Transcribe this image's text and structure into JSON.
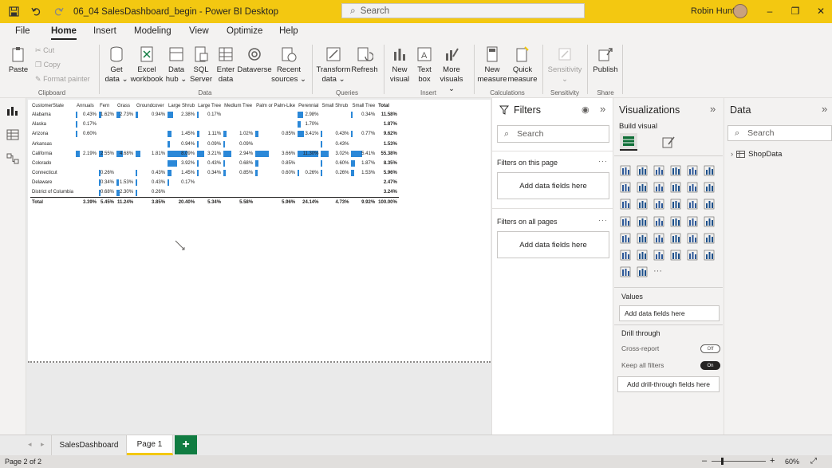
{
  "titlebar": {
    "doc_title": "06_04 SalesDashboard_begin - Power BI Desktop",
    "search_placeholder": "Search",
    "user_name": "Robin Hunt",
    "icons": [
      "save-icon",
      "undo-icon",
      "redo-icon"
    ]
  },
  "menu": {
    "tabs": [
      "File",
      "Home",
      "Insert",
      "Modeling",
      "View",
      "Optimize",
      "Help"
    ],
    "active": "Home"
  },
  "ribbon": {
    "paste": "Paste",
    "cut": "Cut",
    "copy": "Copy",
    "format_painter": "Format painter",
    "clipboard_label": "Clipboard",
    "get_data": [
      "Get",
      "data ⌄"
    ],
    "excel": [
      "Excel",
      "workbook"
    ],
    "data_hub": [
      "Data",
      "hub ⌄"
    ],
    "sql": [
      "SQL",
      "Server"
    ],
    "enter_data": [
      "Enter",
      "data"
    ],
    "dataverse": [
      "Dataverse",
      ""
    ],
    "recent": [
      "Recent",
      "sources ⌄"
    ],
    "data_label": "Data",
    "transform": [
      "Transform",
      "data ⌄"
    ],
    "refresh": [
      "Refresh",
      ""
    ],
    "queries_label": "Queries",
    "new_visual": [
      "New",
      "visual"
    ],
    "text_box": [
      "Text",
      "box"
    ],
    "more_visuals": [
      "More",
      "visuals ⌄"
    ],
    "insert_label": "Insert",
    "new_measure": [
      "New",
      "measure"
    ],
    "quick_measure": [
      "Quick",
      "measure"
    ],
    "calculations_label": "Calculations",
    "sensitivity": [
      "Sensitivity",
      "⌄"
    ],
    "sensitivity_label": "Sensitivity",
    "publish": [
      "Publish",
      ""
    ],
    "share_label": "Share"
  },
  "matrix": {
    "headers": [
      "CustomerState",
      "Annuals",
      "Fern",
      "Grass",
      "Groundcover",
      "Large Shrub",
      "Large Tree",
      "Medium Tree",
      "Palm or Palm-Like",
      "Perennial",
      "Small Shrub",
      "Small Tree",
      "Total"
    ],
    "rows": [
      {
        "state": "Alabama",
        "cells": [
          "0.43%",
          "1.62%",
          "2.73%",
          "0.94%",
          "2.38%",
          "0.17%",
          "",
          "",
          "2.98%",
          "",
          "0.34%"
        ],
        "total": "11.58%"
      },
      {
        "state": "Alaska",
        "cells": [
          "0.17%",
          "",
          "",
          "",
          "",
          "",
          "",
          "",
          "1.70%",
          "",
          ""
        ],
        "total": "1.87%"
      },
      {
        "state": "Arizona",
        "cells": [
          "0.60%",
          "",
          "",
          "",
          "1.45%",
          "1.11%",
          "1.02%",
          "0.85%",
          "3.41%",
          "0.43%",
          "0.77%"
        ],
        "total": "9.62%"
      },
      {
        "state": "Arkansas",
        "cells": [
          "",
          "",
          "",
          "",
          "0.94%",
          "0.09%",
          "0.09%",
          "",
          "",
          "0.43%",
          ""
        ],
        "total": "1.53%"
      },
      {
        "state": "California",
        "cells": [
          "2.19%",
          "2.55%",
          "4.68%",
          "1.81%",
          "8.09%",
          "3.21%",
          "2.94%",
          "3.66%",
          "11.30%",
          "3.02%",
          "5.41%"
        ],
        "total": "55.38%"
      },
      {
        "state": "Colorado",
        "cells": [
          "",
          "",
          "",
          "",
          "3.92%",
          "0.43%",
          "0.68%",
          "0.85%",
          "",
          "0.60%",
          "1.87%"
        ],
        "total": "8.35%"
      },
      {
        "state": "Connecticut",
        "cells": [
          "",
          "0.26%",
          "",
          "0.43%",
          "1.45%",
          "0.34%",
          "0.85%",
          "0.60%",
          "0.26%",
          "0.26%",
          "1.53%"
        ],
        "total": "5.96%"
      },
      {
        "state": "Delaware",
        "cells": [
          "",
          "0.34%",
          "1.53%",
          "0.43%",
          "0.17%",
          "",
          "",
          "",
          "",
          "",
          ""
        ],
        "total": "2.47%"
      },
      {
        "state": "District of Columbia",
        "cells": [
          "",
          "0.68%",
          "2.30%",
          "0.26%",
          "",
          "",
          "",
          "",
          "",
          "",
          ""
        ],
        "total": "3.24%"
      }
    ],
    "totals": {
      "label": "Total",
      "cells": [
        "3.39%",
        "5.45%",
        "11.24%",
        "3.85%",
        "20.40%",
        "5.34%",
        "5.58%",
        "5.96%",
        "24.14%",
        "4.73%",
        "9.92%"
      ],
      "grand": "100.00%"
    }
  },
  "filters": {
    "title": "Filters",
    "search_placeholder": "Search",
    "on_this_page": "Filters on this page",
    "on_all_pages": "Filters on all pages",
    "add_fields": "Add data fields here"
  },
  "viz": {
    "title": "Visualizations",
    "build_visual": "Build visual",
    "values_label": "Values",
    "values_well": "Add data fields here",
    "drill_through": "Drill through",
    "cross_report": "Cross-report",
    "cross_report_state": "Off",
    "keep_filters": "Keep all filters",
    "keep_filters_state": "On",
    "drill_well": "Add drill-through fields here",
    "more": "···"
  },
  "data_pane": {
    "title": "Data",
    "search_placeholder": "Search",
    "table": "ShopData"
  },
  "pages": {
    "tabs": [
      "SalesDashboard",
      "Page 1"
    ],
    "active": "Page 1",
    "add": "+"
  },
  "status": {
    "page": "Page 2 of 2",
    "zoom": "60%"
  },
  "colors": {
    "accent": "#f3c811",
    "bar": "#2b88d8",
    "add_page": "#107c41"
  }
}
